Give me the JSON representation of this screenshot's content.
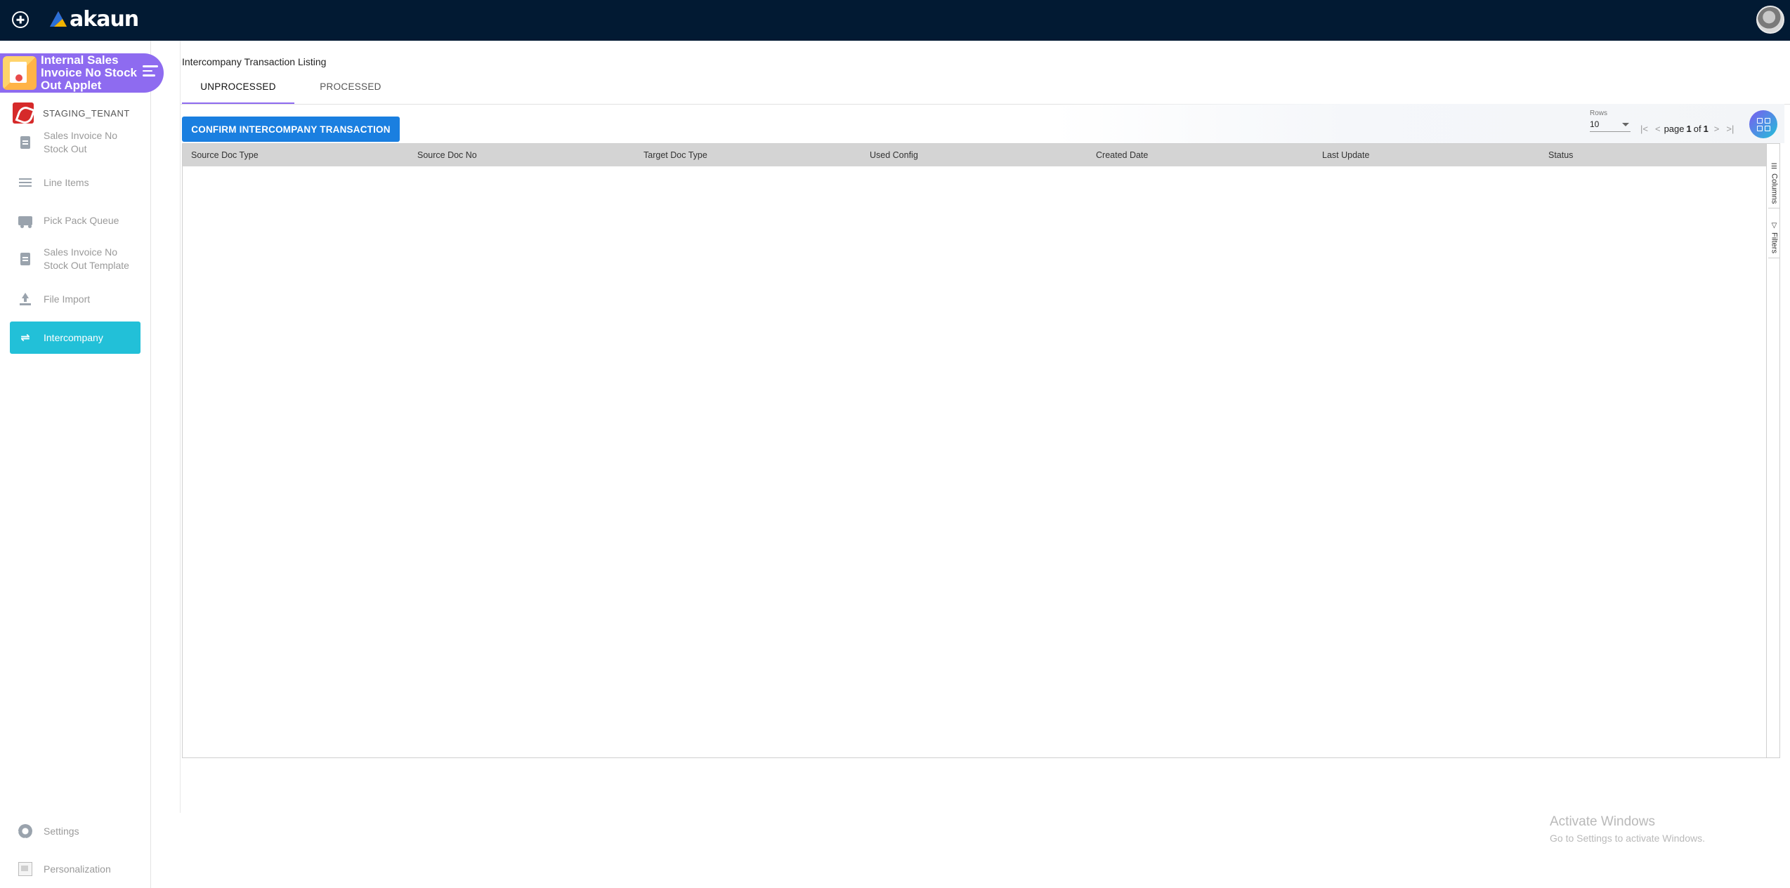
{
  "app": {
    "logo_text": "akaun"
  },
  "sidebar": {
    "applet_title": "Internal Sales Invoice No Stock Out Applet",
    "tenant": "STAGING_TENANT",
    "items": [
      {
        "label": "Sales Invoice No Stock Out",
        "icon": "document-icon"
      },
      {
        "label": "Line Items",
        "icon": "list-icon"
      },
      {
        "label": "Pick Pack Queue",
        "icon": "truck-icon"
      },
      {
        "label": "Sales Invoice No Stock Out Template",
        "icon": "document-icon"
      },
      {
        "label": "File Import",
        "icon": "upload-icon"
      },
      {
        "label": "Intercompany",
        "icon": "swap-icon",
        "active": true
      }
    ],
    "bottom_items": [
      {
        "label": "Settings",
        "icon": "gear-icon"
      },
      {
        "label": "Personalization",
        "icon": "image-icon"
      }
    ]
  },
  "main": {
    "page_title": "Intercompany Transaction Listing",
    "tabs": [
      {
        "label": "UNPROCESSED",
        "active": true
      },
      {
        "label": "PROCESSED",
        "active": false
      }
    ],
    "confirm_button": "CONFIRM INTERCOMPANY TRANSACTION",
    "rows_label": "Rows",
    "rows_value": "10",
    "pager": {
      "page_label": "page",
      "page": "1",
      "of_label": "of",
      "total": "1"
    },
    "grid": {
      "columns": [
        "Source Doc Type",
        "Source Doc No",
        "Target Doc Type",
        "Used Config",
        "Created Date",
        "Last Update",
        "Status"
      ],
      "rows": []
    },
    "side_panel": {
      "columns_label": "Columns",
      "filters_label": "Filters"
    }
  },
  "watermark": {
    "line1": "Activate Windows",
    "line2": "Go to Settings to activate Windows."
  },
  "colors": {
    "topbar": "#021a33",
    "applet_banner": "#8e6bf0",
    "active_nav": "#22c0d8",
    "primary_button": "#1a7fe0",
    "grid_header": "#d4d4d4"
  }
}
